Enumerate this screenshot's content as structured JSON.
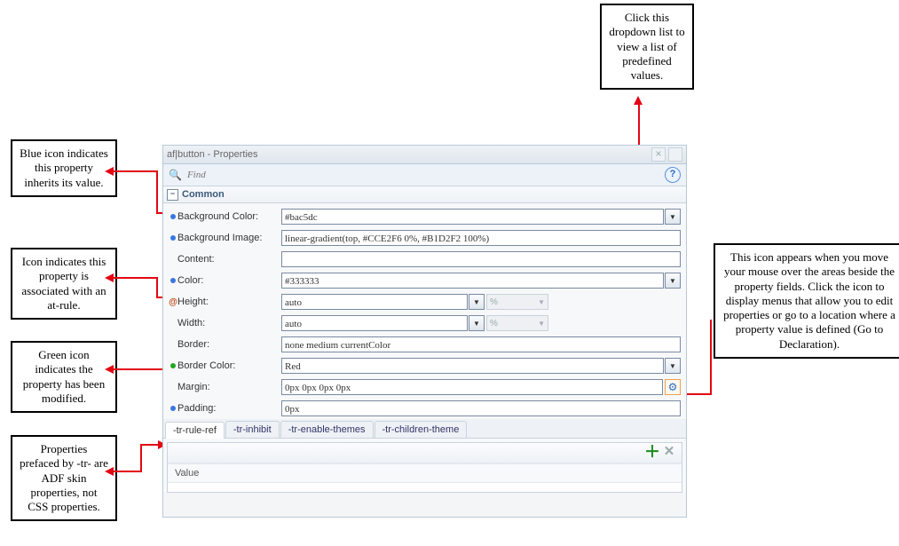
{
  "callouts": {
    "dropdown": "Click this dropdown list to view a list of predefined values.",
    "blue_icon": "Blue icon indicates this property inherits its value.",
    "at_icon": "Icon indicates this property is associated with an at-rule.",
    "green_icon": "Green icon indicates the property has been modified.",
    "tr_props": "Properties prefaced by -tr- are ADF skin properties, not CSS properties.",
    "gear_icon": "This icon appears when you move your mouse over the areas beside the property fields. Click the icon to display menus that allow you to edit properties or go to a location where a property value is defined (Go to Declaration)."
  },
  "panel": {
    "title": "af|button - Properties",
    "find_placeholder": "Find",
    "section": "Common",
    "props": {
      "bg_color": {
        "label": "Background Color:",
        "value": "#bac5dc"
      },
      "bg_image": {
        "label": "Background Image:",
        "value": "linear-gradient(top, #CCE2F6 0%, #B1D2F2 100%)"
      },
      "content": {
        "label": "Content:",
        "value": ""
      },
      "color": {
        "label": "Color:",
        "value": "#333333"
      },
      "height": {
        "label": "Height:",
        "value": "auto",
        "unit": "%"
      },
      "width": {
        "label": "Width:",
        "value": "auto",
        "unit": "%"
      },
      "border": {
        "label": "Border:",
        "value": "none medium currentColor"
      },
      "border_color": {
        "label": "Border Color:",
        "value": "Red"
      },
      "margin": {
        "label": "Margin:",
        "value": "0px 0px 0px 0px"
      },
      "padding": {
        "label": "Padding:",
        "value": "0px"
      }
    },
    "tabs": [
      "-tr-rule-ref",
      "-tr-inhibit",
      "-tr-enable-themes",
      "-tr-children-theme"
    ],
    "table_header": "Value"
  }
}
